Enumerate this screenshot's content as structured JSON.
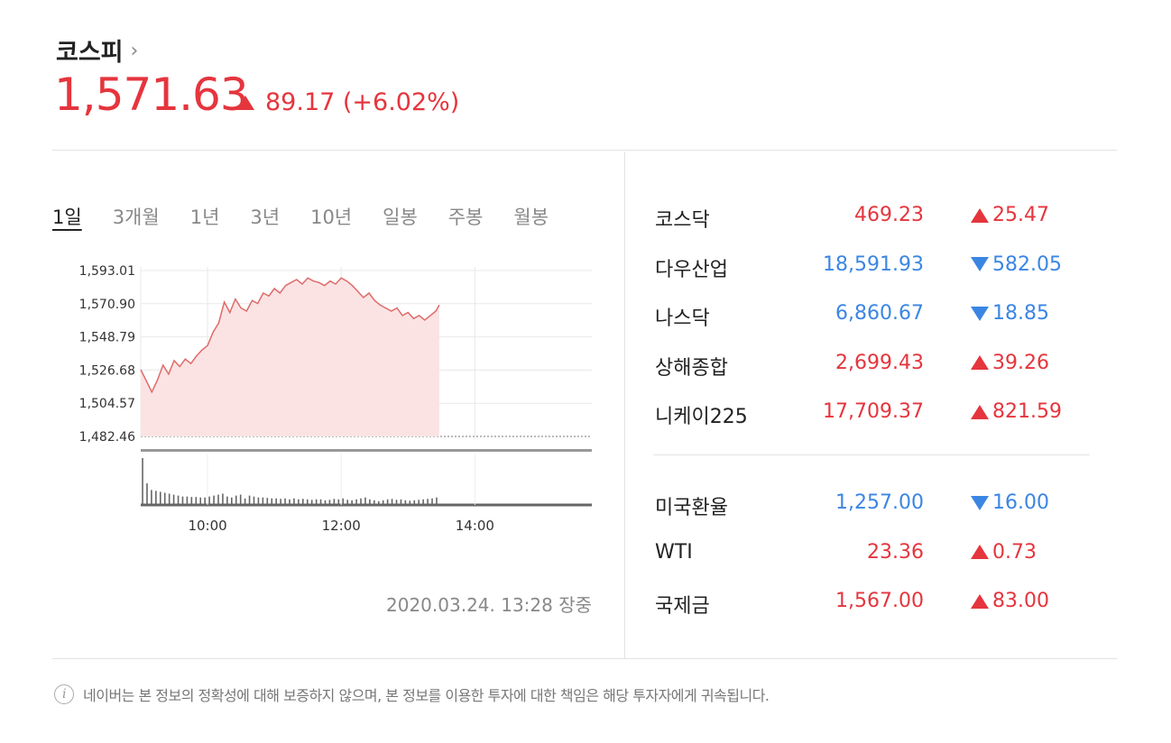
{
  "header": {
    "title": "코스피",
    "chevron": "›",
    "price": "1,571.63",
    "change": "89.17 (+6.02%)"
  },
  "tabs": [
    "1일",
    "3개월",
    "1년",
    "3년",
    "10년",
    "일봉",
    "주봉",
    "월봉"
  ],
  "timestamp": "2020.03.24. 13:28 장중",
  "markets": [
    {
      "name": "코스닥",
      "value": "469.23",
      "change": "25.47",
      "dir": "up"
    },
    {
      "name": "다우산업",
      "value": "18,591.93",
      "change": "582.05",
      "dir": "down"
    },
    {
      "name": "나스닥",
      "value": "6,860.67",
      "change": "18.85",
      "dir": "down"
    },
    {
      "name": "상해종합",
      "value": "2,699.43",
      "change": "39.26",
      "dir": "up"
    },
    {
      "name": "니케이225",
      "value": "17,709.37",
      "change": "821.59",
      "dir": "up"
    }
  ],
  "others": [
    {
      "name": "미국환율",
      "value": "1,257.00",
      "change": "16.00",
      "dir": "down"
    },
    {
      "name": "WTI",
      "value": "23.36",
      "change": "0.73",
      "dir": "up"
    },
    {
      "name": "국제금",
      "value": "1,567.00",
      "change": "83.00",
      "dir": "up"
    }
  ],
  "disclaimer": "네이버는 본 정보의 정확성에 대해 보증하지 않으며, 본 정보를 이용한 투자에 대한 책임은 해당 투자자에게 귀속됩니다.",
  "colors": {
    "up": "#e5353d",
    "down": "#3b86e3"
  },
  "chart_data": {
    "type": "area",
    "y_ticks": [
      "1,593.01",
      "1,570.90",
      "1,548.79",
      "1,526.68",
      "1,504.57",
      "1,482.46"
    ],
    "x_ticks": [
      "10:00",
      "12:00",
      "14:00"
    ],
    "ylim": [
      1482.46,
      1593.01
    ],
    "x_range_minutes": [
      540,
      945
    ],
    "series": [
      {
        "x": [
          540,
          546,
          550,
          555,
          560,
          565,
          570,
          575,
          580,
          585,
          590,
          595,
          600,
          605,
          610,
          615,
          620,
          625,
          630,
          635,
          640,
          645,
          650,
          655,
          660,
          665,
          670,
          675,
          680,
          685,
          690,
          695,
          700,
          705,
          710,
          715,
          720,
          725,
          730,
          735,
          740,
          745,
          750,
          755,
          760,
          765,
          770,
          775,
          780,
          785,
          790,
          795,
          800,
          805,
          808
        ],
        "values": [
          1527,
          1518,
          1512,
          1520,
          1530,
          1524,
          1533,
          1529,
          1534,
          1531,
          1536,
          1540,
          1543,
          1552,
          1558,
          1572,
          1565,
          1574,
          1568,
          1566,
          1573,
          1571,
          1578,
          1576,
          1581,
          1578,
          1583,
          1585,
          1587,
          1584,
          1588,
          1586,
          1585,
          1583,
          1586,
          1584,
          1588,
          1586,
          1583,
          1579,
          1575,
          1578,
          1573,
          1570,
          1568,
          1566,
          1568,
          1563,
          1565,
          1561,
          1563,
          1560,
          1563,
          1566,
          1570
        ]
      }
    ],
    "volume": {
      "x": [
        541,
        545,
        549,
        553,
        557,
        561,
        565,
        569,
        573,
        577,
        581,
        585,
        589,
        593,
        597,
        601,
        605,
        609,
        613,
        617,
        621,
        625,
        629,
        633,
        637,
        641,
        645,
        649,
        653,
        657,
        661,
        665,
        669,
        673,
        677,
        681,
        685,
        689,
        693,
        697,
        701,
        705,
        709,
        713,
        717,
        721,
        725,
        729,
        733,
        737,
        741,
        745,
        749,
        753,
        757,
        761,
        765,
        769,
        773,
        777,
        781,
        785,
        789,
        793,
        797,
        801,
        805
      ],
      "values": [
        100,
        46,
        32,
        30,
        28,
        26,
        24,
        22,
        20,
        18,
        18,
        17,
        17,
        16,
        16,
        18,
        20,
        22,
        24,
        18,
        16,
        20,
        22,
        14,
        20,
        18,
        16,
        16,
        15,
        14,
        14,
        13,
        14,
        12,
        14,
        12,
        13,
        12,
        11,
        12,
        12,
        10,
        11,
        13,
        12,
        14,
        11,
        10,
        12,
        14,
        16,
        12,
        10,
        8,
        10,
        12,
        13,
        11,
        12,
        10,
        9,
        10,
        11,
        12,
        13,
        14,
        16
      ]
    }
  }
}
